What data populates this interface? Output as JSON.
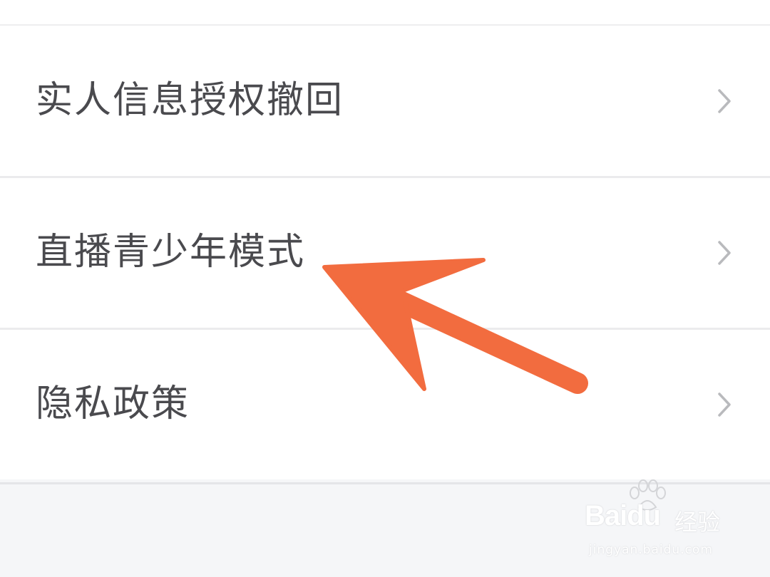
{
  "settings": {
    "items": [
      {
        "label": "实人信息授权撤回",
        "icon": "chevron-right-icon"
      },
      {
        "label": "直播青少年模式",
        "icon": "chevron-right-icon"
      },
      {
        "label": "隐私政策",
        "icon": "chevron-right-icon"
      }
    ]
  },
  "annotation": {
    "arrow_color": "#f26c3f",
    "points_to": "直播青少年模式"
  },
  "watermark": {
    "brand": "Baidu",
    "brand_cn": "经验",
    "url": "jingyan.baidu.com"
  },
  "colors": {
    "background": "#f5f6f8",
    "card": "#ffffff",
    "text": "#4a4a4e",
    "chevron": "#b9babd",
    "divider": "#ebebed"
  }
}
